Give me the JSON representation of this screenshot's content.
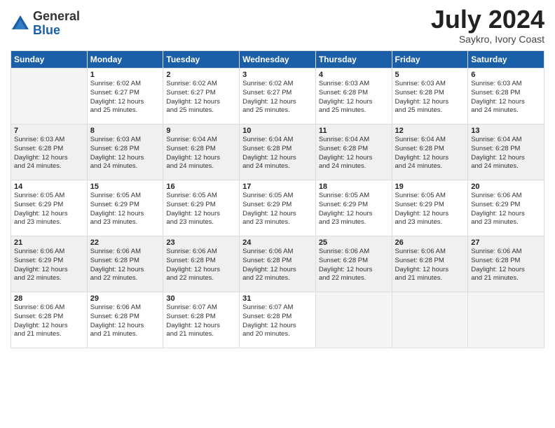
{
  "logo": {
    "general": "General",
    "blue": "Blue"
  },
  "title": {
    "month_year": "July 2024",
    "location": "Saykro, Ivory Coast"
  },
  "weekdays": [
    "Sunday",
    "Monday",
    "Tuesday",
    "Wednesday",
    "Thursday",
    "Friday",
    "Saturday"
  ],
  "weeks": [
    [
      {
        "day": "",
        "info": ""
      },
      {
        "day": "1",
        "info": "Sunrise: 6:02 AM\nSunset: 6:27 PM\nDaylight: 12 hours\nand 25 minutes."
      },
      {
        "day": "2",
        "info": "Sunrise: 6:02 AM\nSunset: 6:27 PM\nDaylight: 12 hours\nand 25 minutes."
      },
      {
        "day": "3",
        "info": "Sunrise: 6:02 AM\nSunset: 6:27 PM\nDaylight: 12 hours\nand 25 minutes."
      },
      {
        "day": "4",
        "info": "Sunrise: 6:03 AM\nSunset: 6:28 PM\nDaylight: 12 hours\nand 25 minutes."
      },
      {
        "day": "5",
        "info": "Sunrise: 6:03 AM\nSunset: 6:28 PM\nDaylight: 12 hours\nand 25 minutes."
      },
      {
        "day": "6",
        "info": "Sunrise: 6:03 AM\nSunset: 6:28 PM\nDaylight: 12 hours\nand 24 minutes."
      }
    ],
    [
      {
        "day": "7",
        "info": "Sunrise: 6:03 AM\nSunset: 6:28 PM\nDaylight: 12 hours\nand 24 minutes."
      },
      {
        "day": "8",
        "info": "Sunrise: 6:03 AM\nSunset: 6:28 PM\nDaylight: 12 hours\nand 24 minutes."
      },
      {
        "day": "9",
        "info": "Sunrise: 6:04 AM\nSunset: 6:28 PM\nDaylight: 12 hours\nand 24 minutes."
      },
      {
        "day": "10",
        "info": "Sunrise: 6:04 AM\nSunset: 6:28 PM\nDaylight: 12 hours\nand 24 minutes."
      },
      {
        "day": "11",
        "info": "Sunrise: 6:04 AM\nSunset: 6:28 PM\nDaylight: 12 hours\nand 24 minutes."
      },
      {
        "day": "12",
        "info": "Sunrise: 6:04 AM\nSunset: 6:28 PM\nDaylight: 12 hours\nand 24 minutes."
      },
      {
        "day": "13",
        "info": "Sunrise: 6:04 AM\nSunset: 6:28 PM\nDaylight: 12 hours\nand 24 minutes."
      }
    ],
    [
      {
        "day": "14",
        "info": "Sunrise: 6:05 AM\nSunset: 6:29 PM\nDaylight: 12 hours\nand 23 minutes."
      },
      {
        "day": "15",
        "info": "Sunrise: 6:05 AM\nSunset: 6:29 PM\nDaylight: 12 hours\nand 23 minutes."
      },
      {
        "day": "16",
        "info": "Sunrise: 6:05 AM\nSunset: 6:29 PM\nDaylight: 12 hours\nand 23 minutes."
      },
      {
        "day": "17",
        "info": "Sunrise: 6:05 AM\nSunset: 6:29 PM\nDaylight: 12 hours\nand 23 minutes."
      },
      {
        "day": "18",
        "info": "Sunrise: 6:05 AM\nSunset: 6:29 PM\nDaylight: 12 hours\nand 23 minutes."
      },
      {
        "day": "19",
        "info": "Sunrise: 6:05 AM\nSunset: 6:29 PM\nDaylight: 12 hours\nand 23 minutes."
      },
      {
        "day": "20",
        "info": "Sunrise: 6:06 AM\nSunset: 6:29 PM\nDaylight: 12 hours\nand 23 minutes."
      }
    ],
    [
      {
        "day": "21",
        "info": "Sunrise: 6:06 AM\nSunset: 6:29 PM\nDaylight: 12 hours\nand 22 minutes."
      },
      {
        "day": "22",
        "info": "Sunrise: 6:06 AM\nSunset: 6:28 PM\nDaylight: 12 hours\nand 22 minutes."
      },
      {
        "day": "23",
        "info": "Sunrise: 6:06 AM\nSunset: 6:28 PM\nDaylight: 12 hours\nand 22 minutes."
      },
      {
        "day": "24",
        "info": "Sunrise: 6:06 AM\nSunset: 6:28 PM\nDaylight: 12 hours\nand 22 minutes."
      },
      {
        "day": "25",
        "info": "Sunrise: 6:06 AM\nSunset: 6:28 PM\nDaylight: 12 hours\nand 22 minutes."
      },
      {
        "day": "26",
        "info": "Sunrise: 6:06 AM\nSunset: 6:28 PM\nDaylight: 12 hours\nand 21 minutes."
      },
      {
        "day": "27",
        "info": "Sunrise: 6:06 AM\nSunset: 6:28 PM\nDaylight: 12 hours\nand 21 minutes."
      }
    ],
    [
      {
        "day": "28",
        "info": "Sunrise: 6:06 AM\nSunset: 6:28 PM\nDaylight: 12 hours\nand 21 minutes."
      },
      {
        "day": "29",
        "info": "Sunrise: 6:06 AM\nSunset: 6:28 PM\nDaylight: 12 hours\nand 21 minutes."
      },
      {
        "day": "30",
        "info": "Sunrise: 6:07 AM\nSunset: 6:28 PM\nDaylight: 12 hours\nand 21 minutes."
      },
      {
        "day": "31",
        "info": "Sunrise: 6:07 AM\nSunset: 6:28 PM\nDaylight: 12 hours\nand 20 minutes."
      },
      {
        "day": "",
        "info": ""
      },
      {
        "day": "",
        "info": ""
      },
      {
        "day": "",
        "info": ""
      }
    ]
  ]
}
